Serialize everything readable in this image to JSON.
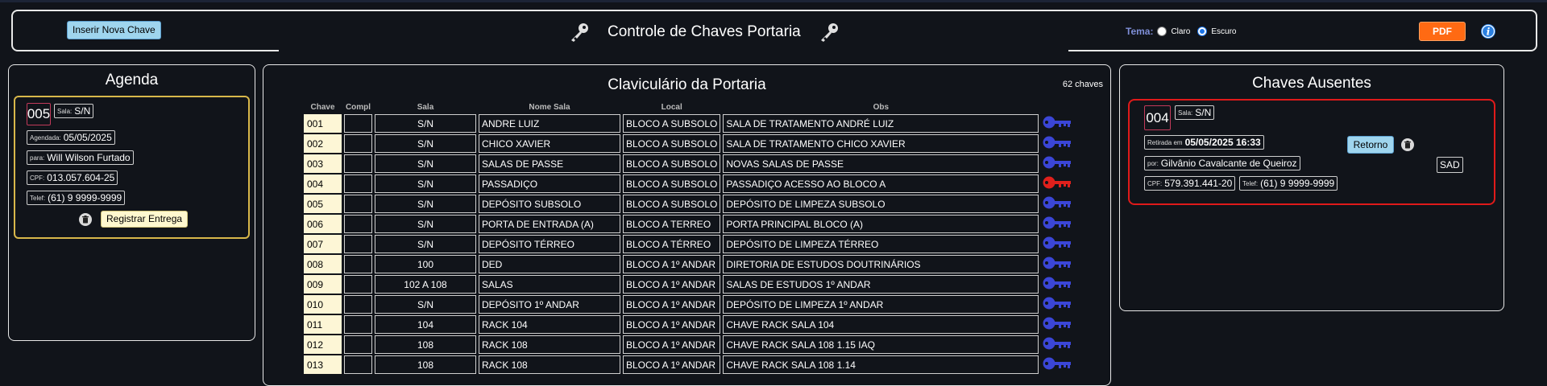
{
  "header": {
    "insert_button": "Inserir Nova Chave",
    "title": "Controle de Chaves Portaria",
    "theme_label": "Tema:",
    "theme_options": [
      "Claro",
      "Escuro"
    ],
    "theme_selected": "Escuro",
    "pdf_button": "PDF"
  },
  "agenda": {
    "title": "Agenda",
    "entry": {
      "chave": "005",
      "sala_label": "Sala:",
      "sala": "S/N",
      "agendada_label": "Agendada:",
      "agendada": "05/05/2025",
      "para_label": "para:",
      "para": "Will Wilson Furtado",
      "cpf_label": "CPF:",
      "cpf": "013.057.604-25",
      "telef_label": "Telef:",
      "telef": "(61) 9 9999-9999",
      "register_button": "Registrar Entrega"
    }
  },
  "central": {
    "title": "Claviculário da Portaria",
    "count": "62 chaves",
    "columns": [
      "Chave",
      "Compl",
      "Sala",
      "Nome Sala",
      "Local",
      "Obs"
    ],
    "rows": [
      {
        "chave": "001",
        "compl": "",
        "sala": "S/N",
        "nome": "ANDRE LUIZ",
        "local": "BLOCO A SUBSOLO",
        "obs": "SALA DE TRATAMENTO ANDRÉ LUIZ",
        "status": "available"
      },
      {
        "chave": "002",
        "compl": "",
        "sala": "S/N",
        "nome": "CHICO XAVIER",
        "local": "BLOCO A SUBSOLO",
        "obs": "SALA DE TRATAMENTO CHICO XAVIER",
        "status": "available"
      },
      {
        "chave": "003",
        "compl": "",
        "sala": "S/N",
        "nome": "SALAS DE PASSE",
        "local": "BLOCO A SUBSOLO",
        "obs": "NOVAS SALAS DE PASSE",
        "status": "available"
      },
      {
        "chave": "004",
        "compl": "",
        "sala": "S/N",
        "nome": "PASSADIÇO",
        "local": "BLOCO A SUBSOLO",
        "obs": "PASSADIÇO ACESSO AO BLOCO A",
        "status": "absent"
      },
      {
        "chave": "005",
        "compl": "",
        "sala": "S/N",
        "nome": "DEPÓSITO SUBSOLO",
        "local": "BLOCO A SUBSOLO",
        "obs": "DEPÓSITO DE LIMPEZA SUBSOLO",
        "status": "available"
      },
      {
        "chave": "006",
        "compl": "",
        "sala": "S/N",
        "nome": "PORTA DE ENTRADA (A)",
        "local": "BLOCO A TERREO",
        "obs": "PORTA PRINCIPAL BLOCO (A)",
        "status": "available"
      },
      {
        "chave": "007",
        "compl": "",
        "sala": "S/N",
        "nome": "DEPÓSITO TÉRREO",
        "local": "BLOCO A TÉRREO",
        "obs": "DEPÓSITO DE LIMPEZA TÉRREO",
        "status": "available"
      },
      {
        "chave": "008",
        "compl": "",
        "sala": "100",
        "nome": "DED",
        "local": "BLOCO A 1º ANDAR",
        "obs": "DIRETORIA DE ESTUDOS DOUTRINÁRIOS",
        "status": "available"
      },
      {
        "chave": "009",
        "compl": "",
        "sala": "102 A 108",
        "nome": "SALAS",
        "local": "BLOCO A 1º ANDAR",
        "obs": "SALAS DE ESTUDOS 1º ANDAR",
        "status": "available"
      },
      {
        "chave": "010",
        "compl": "",
        "sala": "S/N",
        "nome": "DEPÓSITO 1º ANDAR",
        "local": "BLOCO A 1º ANDAR",
        "obs": "DEPÓSITO DE LIMPEZA 1º ANDAR",
        "status": "available"
      },
      {
        "chave": "011",
        "compl": "",
        "sala": "104",
        "nome": "RACK 104",
        "local": "BLOCO A 1º ANDAR",
        "obs": "CHAVE RACK SALA 104",
        "status": "available"
      },
      {
        "chave": "012",
        "compl": "",
        "sala": "108",
        "nome": "RACK 108",
        "local": "BLOCO A 1º ANDAR",
        "obs": "CHAVE RACK SALA 108 1.15 IAQ",
        "status": "available"
      },
      {
        "chave": "013",
        "compl": "",
        "sala": "108",
        "nome": "RACK 108",
        "local": "BLOCO A 1º ANDAR",
        "obs": "CHAVE RACK SALA 108 1.14",
        "status": "available"
      }
    ]
  },
  "ausentes": {
    "title": "Chaves Ausentes",
    "entry": {
      "chave": "004",
      "sala_label": "Sala:",
      "sala": "S/N",
      "retirada_label": "Retirada em",
      "retirada": "05/05/2025 16:33",
      "por_label": "por:",
      "por": "Gilvânio Cavalcante de Queiroz",
      "cpf_label": "CPF:",
      "cpf": "579.391.441-20",
      "telef_label": "Telef:",
      "telef": "(61) 9 9999-9999",
      "sigla": "SAD",
      "return_button": "Retorno"
    }
  },
  "colors": {
    "key_available": "#3b46d6",
    "key_absent": "#e0201c",
    "pdf": "#ff6a13",
    "agenda_border": "#d8b74a",
    "absent_border": "#e01a1a"
  }
}
